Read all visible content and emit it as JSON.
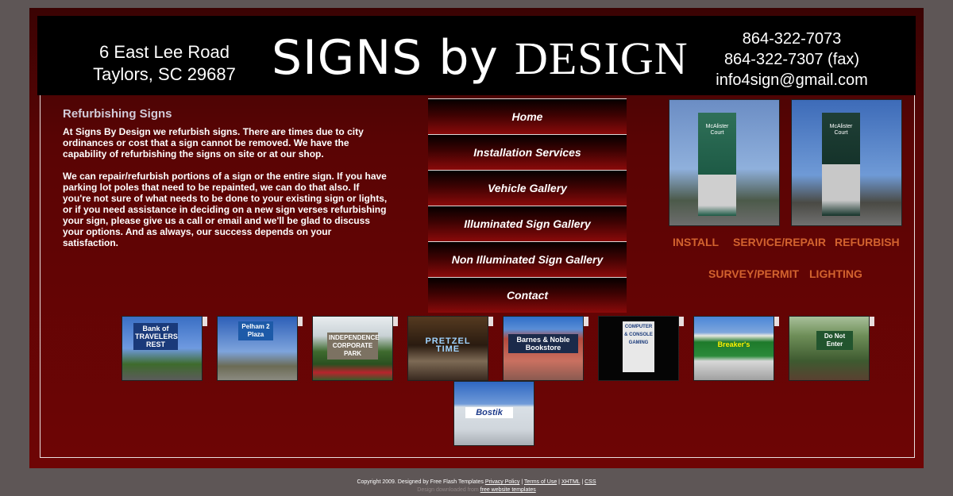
{
  "header": {
    "address_line1": "6 East Lee Road",
    "address_line2": "Taylors, SC 29687",
    "logo_part1": "SIGNS by ",
    "logo_part2": "DESIGN",
    "phone": "864-322-7073",
    "fax": "864-322-7307 (fax)",
    "email": "info4sign@gmail.com"
  },
  "content": {
    "title": "Refurbishing Signs",
    "paragraph1": "At Signs By Design we refurbish signs.   There are times due to city ordinances or cost that a sign cannot be removed.   We have the capability of refurbishing the signs on site or at our shop.",
    "paragraph2": "We can repair/refurbish portions of a sign or the entire sign.   If you have parking lot poles that need to be repainted, we can do that also.   If you're not sure of what needs to be done to your existing sign or lights, or if you need assistance in deciding on a new sign verses refurbishing your sign, please give us a call or email and we'll be glad to discuss your options. And as always, our success depends on your satisfaction."
  },
  "nav": {
    "items": [
      {
        "label": "Home"
      },
      {
        "label": "Installation Services"
      },
      {
        "label": "Vehicle Gallery"
      },
      {
        "label": "Illuminated Sign Gallery"
      },
      {
        "label": "Non Illuminated Sign Gallery"
      },
      {
        "label": "Contact"
      }
    ]
  },
  "side_images": {
    "img1_label": "McAlister Court",
    "img2_label": "McAlister Court"
  },
  "service_links": {
    "install": "INSTALL",
    "service_repair": "SERVICE/REPAIR",
    "refurbish": "REFURBISH",
    "survey_permit": "SURVEY/PERMIT",
    "lighting": "LIGHTING"
  },
  "thumbnails": [
    {
      "caption": "Bank of TRAVELERS REST"
    },
    {
      "caption": "Pelham 2 Plaza"
    },
    {
      "caption": "INDEPENDENCE CORPORATE PARK"
    },
    {
      "caption": "PRETZEL TIME"
    },
    {
      "caption": "Barnes & Noble Bookstore"
    },
    {
      "caption": "COMPUTER & CONSOLE GAMING"
    },
    {
      "caption": "Breaker's"
    },
    {
      "caption": "Do Not Enter"
    },
    {
      "caption": "Bostik"
    }
  ],
  "footer": {
    "copyright": "Copyright 2009. Designed by Free Flash Templates",
    "privacy": "Privacy Policy",
    "terms": "Terms of Use",
    "xhtml": "XHTML",
    "css": "CSS",
    "downloaded": "Design downloaded from",
    "templates_link": "free website templates"
  },
  "colors": {
    "background": "#5e5656",
    "frame": "#6e0505",
    "header": "#000000",
    "service_link": "#d2622e",
    "content_title": "#d2cbd8"
  }
}
